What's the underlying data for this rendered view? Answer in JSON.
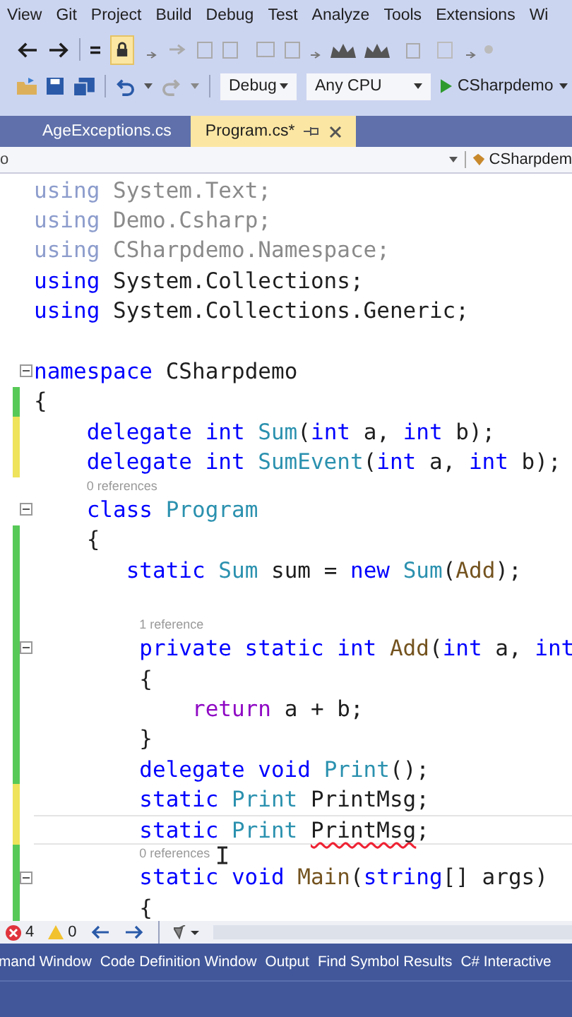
{
  "menu": [
    "View",
    "Git",
    "Project",
    "Build",
    "Debug",
    "Test",
    "Analyze",
    "Tools",
    "Extensions",
    "Wi"
  ],
  "toolbar": {
    "lock": {
      "on": true
    },
    "configuration": "Debug",
    "platform": "Any CPU",
    "start": "CSharpdemo"
  },
  "tabs": [
    {
      "label": "AgeExceptions.cs",
      "selected": false
    },
    {
      "label": "Program.cs*",
      "selected": true
    }
  ],
  "nav_bar": {
    "left": "o",
    "right": "CSharpdem"
  },
  "editor": {
    "lines": [
      {
        "kind": "code",
        "tokens": [
          {
            "kind": "unused_keyword",
            "s": "using"
          },
          {
            "kind": "unused",
            "s": " System.Text;"
          }
        ]
      },
      {
        "kind": "code",
        "tokens": [
          {
            "kind": "unused_keyword",
            "s": "using"
          },
          {
            "kind": "unused",
            "s": " Demo.Csharp;"
          }
        ]
      },
      {
        "kind": "code",
        "tokens": [
          {
            "kind": "unused_keyword",
            "s": "using"
          },
          {
            "kind": "unused",
            "s": " CSharpdemo.Namespace;"
          }
        ]
      },
      {
        "kind": "code",
        "tokens": [
          {
            "kind": "keyword",
            "s": "using"
          },
          {
            "kind": "plain",
            "s": " System.Collections;"
          }
        ]
      },
      {
        "kind": "code",
        "tokens": [
          {
            "kind": "keyword",
            "s": "using"
          },
          {
            "kind": "plain",
            "s": " System.Collections.Generic;"
          }
        ]
      },
      {
        "kind": "blank"
      },
      {
        "kind": "code",
        "collapsible": true,
        "tokens": [
          {
            "kind": "keyword",
            "s": "namespace"
          },
          {
            "kind": "plain",
            "s": " CSharpdemo"
          }
        ]
      },
      {
        "kind": "code",
        "saved": true,
        "tokens": [
          {
            "kind": "plain",
            "s": "{"
          }
        ]
      },
      {
        "kind": "code",
        "saved": false,
        "tokens": [
          {
            "kind": "keyword",
            "s": "    delegate int "
          },
          {
            "kind": "type",
            "s": "Sum"
          },
          {
            "kind": "plain",
            "s": "("
          },
          {
            "kind": "keyword",
            "s": "int"
          },
          {
            "kind": "plain",
            "s": " a, "
          },
          {
            "kind": "keyword",
            "s": "int"
          },
          {
            "kind": "plain",
            "s": " b);"
          }
        ]
      },
      {
        "kind": "code",
        "saved": false,
        "tokens": [
          {
            "kind": "keyword",
            "s": "    delegate int "
          },
          {
            "kind": "type",
            "s": "SumEvent"
          },
          {
            "kind": "plain",
            "s": "("
          },
          {
            "kind": "keyword",
            "s": "int"
          },
          {
            "kind": "plain",
            "s": " a, "
          },
          {
            "kind": "keyword",
            "s": "int"
          },
          {
            "kind": "plain",
            "s": " b);"
          }
        ]
      },
      {
        "kind": "lens",
        "text": "0 references"
      },
      {
        "kind": "code",
        "collapsible": true,
        "tokens": [
          {
            "kind": "keyword",
            "s": "    class "
          },
          {
            "kind": "type",
            "s": "Program"
          }
        ]
      },
      {
        "kind": "code",
        "saved": true,
        "tokens": [
          {
            "kind": "plain",
            "s": "    {"
          }
        ]
      },
      {
        "kind": "code",
        "saved": true,
        "tokens": [
          {
            "kind": "keyword",
            "s": "       static "
          },
          {
            "kind": "type",
            "s": "Sum"
          },
          {
            "kind": "plain",
            "s": " sum = "
          },
          {
            "kind": "keyword",
            "s": "new "
          },
          {
            "kind": "type",
            "s": "Sum"
          },
          {
            "kind": "plain",
            "s": "("
          },
          {
            "kind": "method",
            "s": "Add"
          },
          {
            "kind": "plain",
            "s": ");"
          }
        ]
      },
      {
        "kind": "blank",
        "saved": true
      },
      {
        "kind": "lens",
        "text": "1 reference",
        "saved": true
      },
      {
        "kind": "code",
        "collapsible": true,
        "saved": true,
        "tokens": [
          {
            "kind": "keyword",
            "s": "        private static int "
          },
          {
            "kind": "method",
            "s": "Add"
          },
          {
            "kind": "plain",
            "s": "("
          },
          {
            "kind": "keyword",
            "s": "int"
          },
          {
            "kind": "plain",
            "s": " a, "
          },
          {
            "kind": "keyword",
            "s": "int"
          }
        ]
      },
      {
        "kind": "code",
        "saved": true,
        "tokens": [
          {
            "kind": "plain",
            "s": "        {"
          }
        ]
      },
      {
        "kind": "code",
        "saved": true,
        "tokens": [
          {
            "kind": "control",
            "s": "            return"
          },
          {
            "kind": "plain",
            "s": " a + b;"
          }
        ]
      },
      {
        "kind": "code",
        "saved": true,
        "tokens": [
          {
            "kind": "plain",
            "s": "        }"
          }
        ]
      },
      {
        "kind": "code",
        "saved": true,
        "tokens": [
          {
            "kind": "keyword",
            "s": "        delegate void "
          },
          {
            "kind": "type",
            "s": "Print"
          },
          {
            "kind": "plain",
            "s": "();"
          }
        ]
      },
      {
        "kind": "code",
        "saved": false,
        "tokens": [
          {
            "kind": "keyword",
            "s": "        static "
          },
          {
            "kind": "type",
            "s": "Print"
          },
          {
            "kind": "plain",
            "s": " PrintMsg;"
          }
        ]
      },
      {
        "kind": "code",
        "saved": false,
        "current": true,
        "tokens": [
          {
            "kind": "keyword",
            "s": "        static "
          },
          {
            "kind": "type",
            "s": "Print "
          },
          {
            "kind": "plain",
            "s": "PrintMsg",
            "error": true
          },
          {
            "kind": "plain",
            "s": ";"
          }
        ]
      },
      {
        "kind": "lens",
        "text": "0 references",
        "saved": true
      },
      {
        "kind": "code",
        "collapsible": true,
        "saved": true,
        "tokens": [
          {
            "kind": "keyword",
            "s": "        static void "
          },
          {
            "kind": "method",
            "s": "Main"
          },
          {
            "kind": "plain",
            "s": "("
          },
          {
            "kind": "keyword",
            "s": "string"
          },
          {
            "kind": "plain",
            "s": "[] args)"
          }
        ]
      },
      {
        "kind": "code",
        "saved": true,
        "tokens": [
          {
            "kind": "plain",
            "s": "        {"
          }
        ]
      }
    ]
  },
  "status": {
    "errors": "4",
    "warnings": "0"
  },
  "tool_tabs": [
    "mand Window",
    "Code Definition Window",
    "Output",
    "Find Symbol Results",
    "C# Interactive"
  ]
}
